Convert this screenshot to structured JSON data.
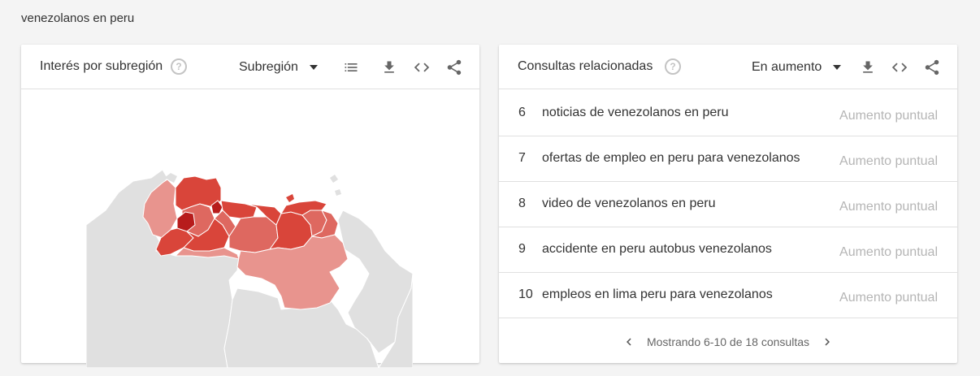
{
  "page": {
    "title": "venezolanos en peru"
  },
  "left_card": {
    "title": "Interés por subregión",
    "help_icon": "?",
    "selector_value": "Subregión",
    "icons": [
      "help-icon",
      "list-icon",
      "download-icon",
      "embed-icon",
      "share-icon"
    ],
    "colors": {
      "highest": "#b71c1c",
      "high": "#d9453a",
      "medium": "#de6860",
      "low": "#e8948e",
      "none": "#e0e0e0"
    }
  },
  "right_card": {
    "title": "Consultas relacionadas",
    "help_icon": "?",
    "selector_value": "En aumento",
    "rows": [
      {
        "rank": "6",
        "query": "noticias de venezolanos en peru",
        "value": "Aumento puntual"
      },
      {
        "rank": "7",
        "query": "ofertas de empleo en peru para venezolanos",
        "value": "Aumento puntual"
      },
      {
        "rank": "8",
        "query": "video de venezolanos en peru",
        "value": "Aumento puntual"
      },
      {
        "rank": "9",
        "query": "accidente en peru autobus venezolanos",
        "value": "Aumento puntual"
      },
      {
        "rank": "10",
        "query": "empleos en lima peru para venezolanos",
        "value": "Aumento puntual"
      }
    ],
    "pagination": "Mostrando 6-10 de 18 consultas"
  }
}
